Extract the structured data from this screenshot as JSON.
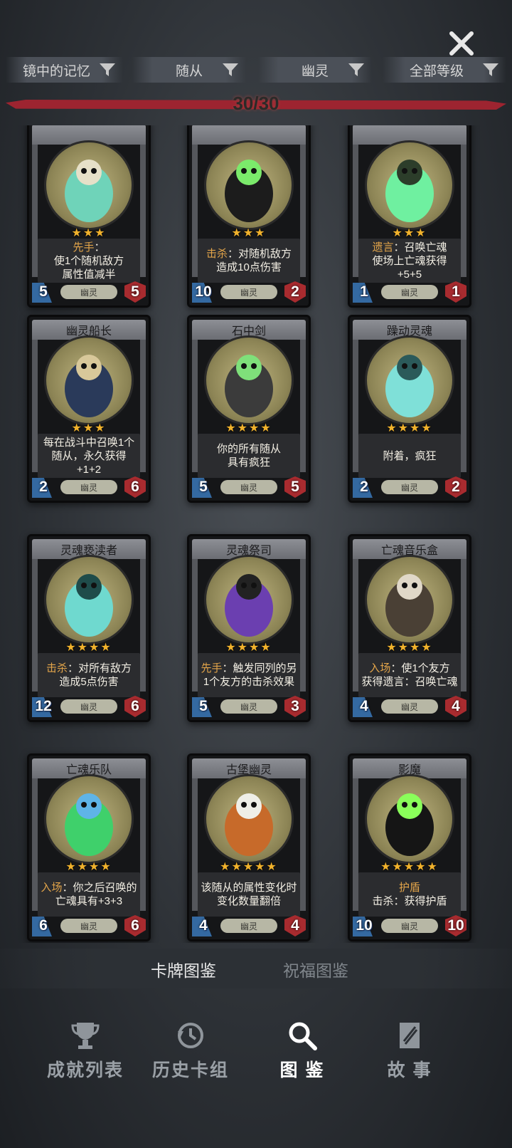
{
  "filters": [
    {
      "label": "镜中的记忆"
    },
    {
      "label": "随从"
    },
    {
      "label": "幽灵"
    },
    {
      "label": "全部等级"
    }
  ],
  "progress": {
    "label": "30/30",
    "value": 30,
    "max": 30
  },
  "cards": [
    {
      "name": "",
      "stars": "★★★",
      "desc_kw": "先手",
      "desc": "：\n使1个随机敌方\n属性值减半",
      "atk": "5",
      "type": "幽灵",
      "hp": "5",
      "art": "skull-ghost"
    },
    {
      "name": "",
      "stars": "★★★",
      "desc_kw": "击杀",
      "desc": "：对随机敌方\n造成10点伤害",
      "atk": "10",
      "type": "幽灵",
      "hp": "2",
      "art": "wraith"
    },
    {
      "name": "",
      "stars": "★★★",
      "desc_kw": "遗言",
      "desc": "：召唤亡魂\n使场上亡魂获得\n+5+5",
      "atk": "1",
      "type": "幽灵",
      "hp": "1",
      "art": "spirit-box"
    },
    {
      "name": "幽灵船长",
      "stars": "★★★",
      "desc_kw": "",
      "desc": "每在战斗中召唤1个\n随从，永久获得+1+2",
      "atk": "2",
      "type": "幽灵",
      "hp": "6",
      "art": "captain"
    },
    {
      "name": "石中剑",
      "stars": "★★★★",
      "desc_kw": "",
      "desc": "你的所有随从\n具有疯狂",
      "atk": "5",
      "type": "幽灵",
      "hp": "5",
      "art": "sword"
    },
    {
      "name": "躁动灵魂",
      "stars": "★★★★",
      "desc_kw": "",
      "desc": "附着，疯狂",
      "atk": "2",
      "type": "幽灵",
      "hp": "2",
      "art": "restless"
    },
    {
      "name": "灵魂亵渎者",
      "stars": "★★★★",
      "desc_kw": "击杀",
      "desc": "：对所有敌方\n造成5点伤害",
      "atk": "12",
      "type": "幽灵",
      "hp": "6",
      "art": "maw"
    },
    {
      "name": "灵魂祭司",
      "stars": "★★★★",
      "desc_kw": "先手",
      "desc": "：触发同列的另\n1个友方的击杀效果",
      "atk": "5",
      "type": "幽灵",
      "hp": "3",
      "art": "priest"
    },
    {
      "name": "亡魂音乐盒",
      "stars": "★★★★",
      "desc_kw": "入场",
      "desc": "：使1个友方\n获得遗言：召唤亡魂",
      "atk": "4",
      "type": "幽灵",
      "hp": "4",
      "art": "music-box"
    },
    {
      "name": "亡魂乐队",
      "stars": "★★★★",
      "desc_kw": "入场",
      "desc": "：你之后召唤的\n亡魂具有+3+3",
      "atk": "6",
      "type": "幽灵",
      "hp": "6",
      "art": "band"
    },
    {
      "name": "古堡幽灵",
      "stars": "★★★★★",
      "desc_kw": "",
      "desc": "该随从的属性变化时\n变化数量翻倍",
      "atk": "4",
      "type": "幽灵",
      "hp": "4",
      "art": "pumpkins"
    },
    {
      "name": "影魔",
      "stars": "★★★★★",
      "desc_kw": "护盾",
      "desc": "\n击杀：获得护盾",
      "atk": "10",
      "type": "幽灵",
      "hp": "10",
      "art": "shadow"
    }
  ],
  "tabs": [
    {
      "label": "卡牌图鉴"
    },
    {
      "label": "祝福图鉴"
    }
  ],
  "nav": [
    {
      "label": "成就列表",
      "icon": "trophy-icon"
    },
    {
      "label": "历史卡组",
      "icon": "history-icon"
    },
    {
      "label": "图 鉴",
      "icon": "magnifier-icon"
    },
    {
      "label": "故 事",
      "icon": "book-icon"
    }
  ],
  "colors": {
    "accent": "#e3a54a",
    "star": "#f1b22c",
    "progress": "#9d2430",
    "atk": "#3c7ec4",
    "hp": "#a82b2f"
  }
}
